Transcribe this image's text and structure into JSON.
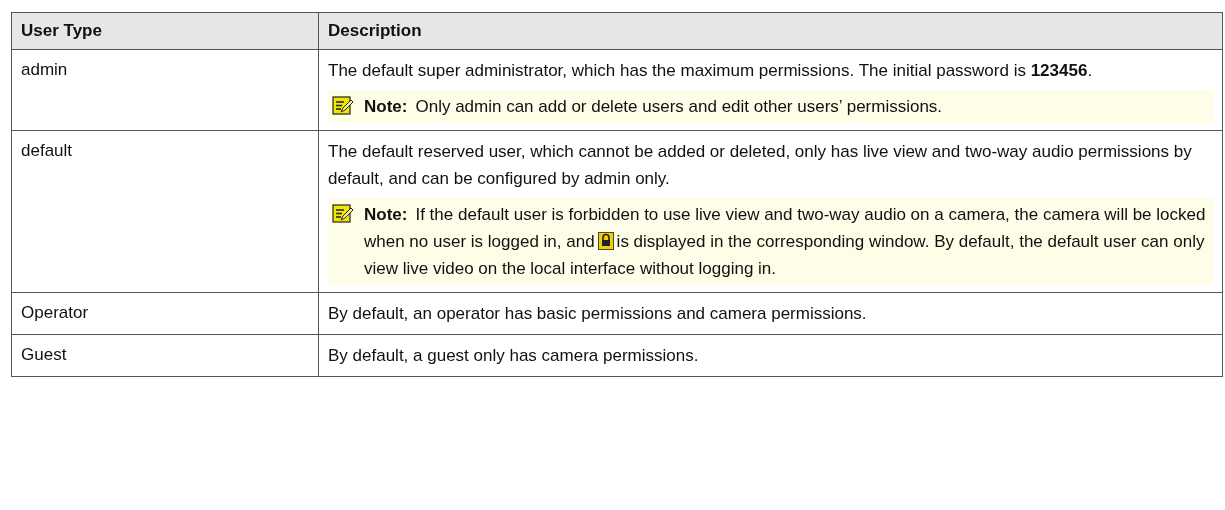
{
  "table": {
    "columns": [
      "User Type",
      "Description"
    ],
    "rows": [
      {
        "user_type": "admin",
        "description": "The default super administrator, which has the maximum permissions. The initial password is **123456**.",
        "note": {
          "label": "Note:",
          "text_before": "Only admin can add or delete users and edit other users’ permissions."
        }
      },
      {
        "user_type": "default",
        "description": "The default reserved user, which cannot be added or deleted, only has live view and two-way audio permissions by default, and can be configured by admin only.",
        "note": {
          "label": "Note:",
          "text_before": "If the default user is forbidden to use live view and two-way audio on a camera, the camera will be locked when no user is logged in, and",
          "text_after": "is displayed in the corresponding window. By default, the default user can only view live video on the local interface without logging in."
        }
      },
      {
        "user_type": "Operator",
        "description": "By default, an operator has basic permissions and camera permissions."
      },
      {
        "user_type": "Guest",
        "description": "By default, a guest only has camera permissions."
      }
    ]
  }
}
